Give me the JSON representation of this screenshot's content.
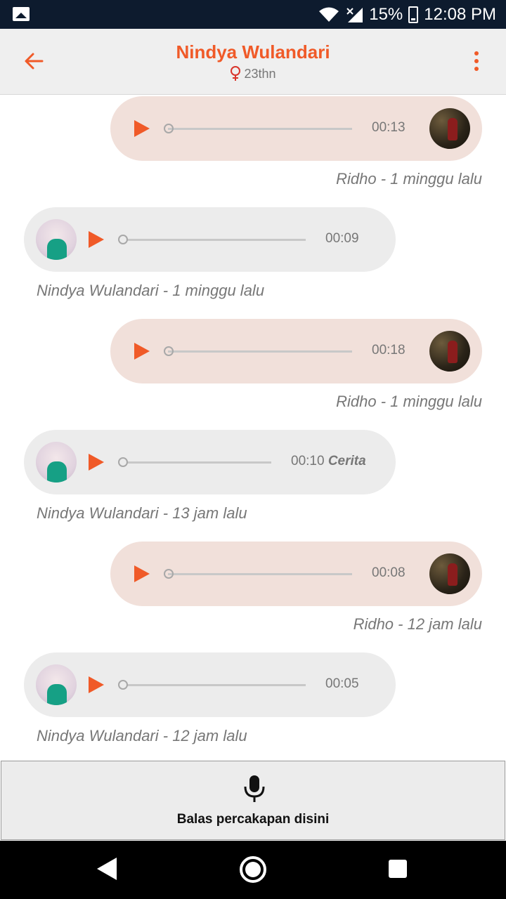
{
  "status_bar": {
    "battery": "15%",
    "time": "12:08 PM"
  },
  "header": {
    "title": "Nindya Wulandari",
    "age": "23thn"
  },
  "messages": [
    {
      "direction": "out",
      "duration": "00:13",
      "tag": "",
      "meta": "Ridho - 1 minggu lalu"
    },
    {
      "direction": "in",
      "duration": "00:09",
      "tag": "",
      "meta": "Nindya Wulandari - 1 minggu lalu"
    },
    {
      "direction": "out",
      "duration": "00:18",
      "tag": "",
      "meta": "Ridho - 1 minggu lalu"
    },
    {
      "direction": "in",
      "duration": "00:10",
      "tag": "Cerita",
      "meta": "Nindya Wulandari - 13 jam lalu"
    },
    {
      "direction": "out",
      "duration": "00:08",
      "tag": "",
      "meta": "Ridho - 12 jam lalu"
    },
    {
      "direction": "in",
      "duration": "00:05",
      "tag": "",
      "meta": "Nindya Wulandari - 12 jam lalu"
    }
  ],
  "reply": {
    "label": "Balas percakapan disini"
  },
  "colors": {
    "accent": "#f05a28",
    "outgoing_bubble": "#f1e0da",
    "incoming_bubble": "#ececec"
  }
}
